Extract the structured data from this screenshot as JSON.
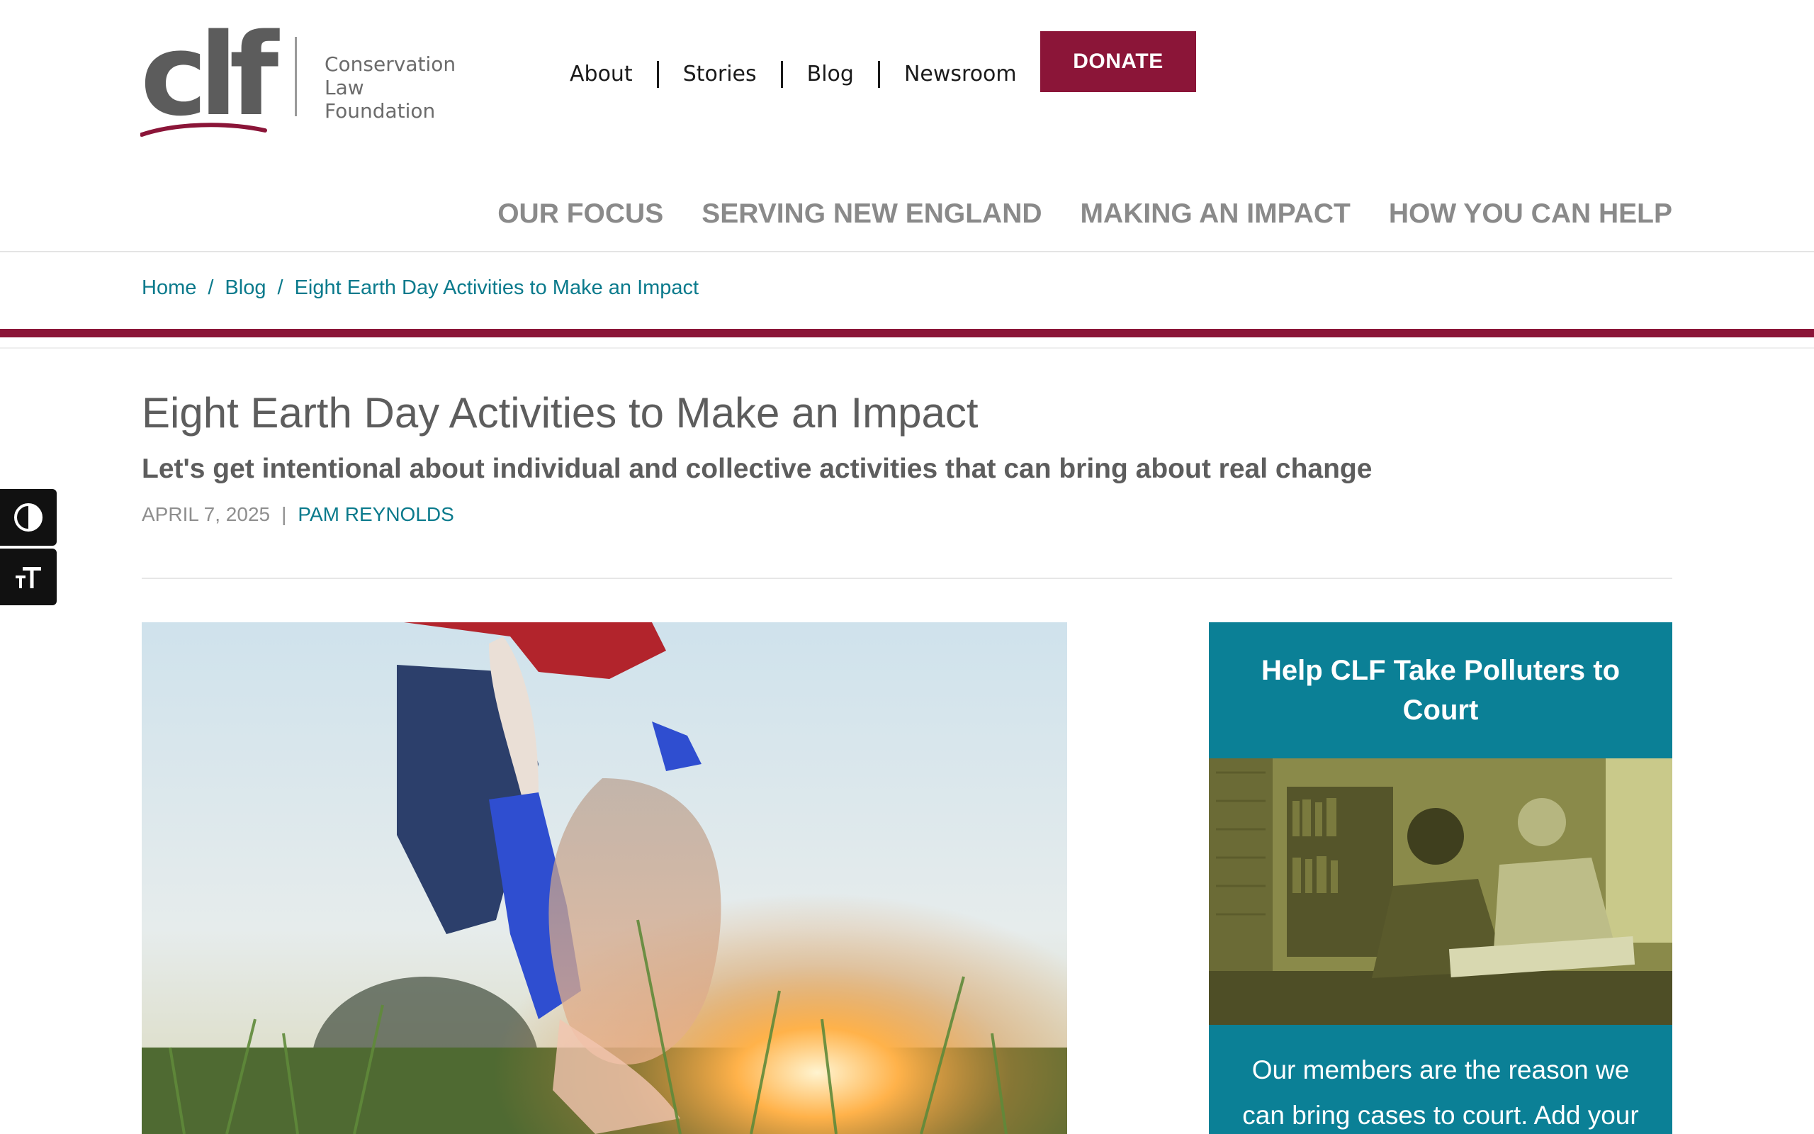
{
  "header": {
    "logo": {
      "mark": "clf",
      "name_line1": "Conservation",
      "name_line2": "Law Foundation"
    },
    "utility_nav": [
      "About",
      "Stories",
      "Blog",
      "Newsroom"
    ],
    "donate_label": "DONATE",
    "main_nav": [
      "OUR FOCUS",
      "SERVING NEW ENGLAND",
      "MAKING AN IMPACT",
      "HOW YOU CAN HELP"
    ]
  },
  "breadcrumb": {
    "items": [
      "Home",
      "Blog",
      "Eight Earth Day Activities to Make an Impact"
    ],
    "separator": "/"
  },
  "article": {
    "title": "Eight Earth Day Activities to Make an Impact",
    "subtitle": "Let's get intentional about individual and collective activities that can bring about real change",
    "date": "APRIL 7, 2025",
    "meta_separator": "|",
    "author": "PAM REYNOLDS"
  },
  "accessibility_tools": [
    {
      "icon": "contrast-icon"
    },
    {
      "icon": "text-size-icon"
    }
  ],
  "sidebar_card": {
    "title": "Help CLF Take Polluters to Court",
    "body": "Our members are the reason we can bring cases to court. Add your name to"
  },
  "colors": {
    "brand_maroon": "#8b1538",
    "teal": "#0b8096",
    "link_teal": "#0a7a8c",
    "text_gray": "#5d5d5d",
    "nav_gray": "#8a8a8a"
  }
}
